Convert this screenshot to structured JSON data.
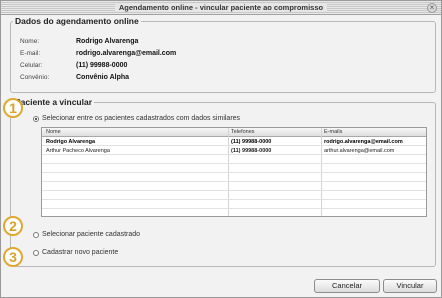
{
  "window": {
    "title": "Agendamento online - vincular paciente ao compromisso"
  },
  "dados": {
    "legend": "Dados do agendamento online",
    "rows": [
      {
        "label": "Nome:",
        "value": "Rodrigo Alvarenga"
      },
      {
        "label": "E-mail:",
        "value": "rodrigo.alvarenga@email.com"
      },
      {
        "label": "Celular:",
        "value": "(11) 99988-0000"
      },
      {
        "label": "Convênio:",
        "value": "Convênio Alpha"
      }
    ]
  },
  "paciente": {
    "legend": "Paciente a vincular",
    "option1": "Selecionar entre os pacientes cadastrados com dados similares",
    "option2": "Selecionar paciente cadastrado",
    "option3": "Cadastrar novo paciente",
    "selected_option": 1,
    "table": {
      "columns": [
        "Nome",
        "Telefones",
        "E-mails"
      ],
      "rows": [
        {
          "nome": "Rodrigo Alvarenga",
          "telefones": "(11) 99988-0000",
          "emails": "rodrigo.alvarenga@email.com"
        },
        {
          "nome": "Arthur Pacheco Alvarenga",
          "telefones": "(11) 99988-0000",
          "emails": "arthur.alvarenga@email.com"
        }
      ]
    }
  },
  "badges": [
    "1",
    "2",
    "3"
  ],
  "buttons": {
    "cancel": "Cancelar",
    "ok": "Vincular"
  },
  "colors": {
    "badge": "#e0a830"
  }
}
